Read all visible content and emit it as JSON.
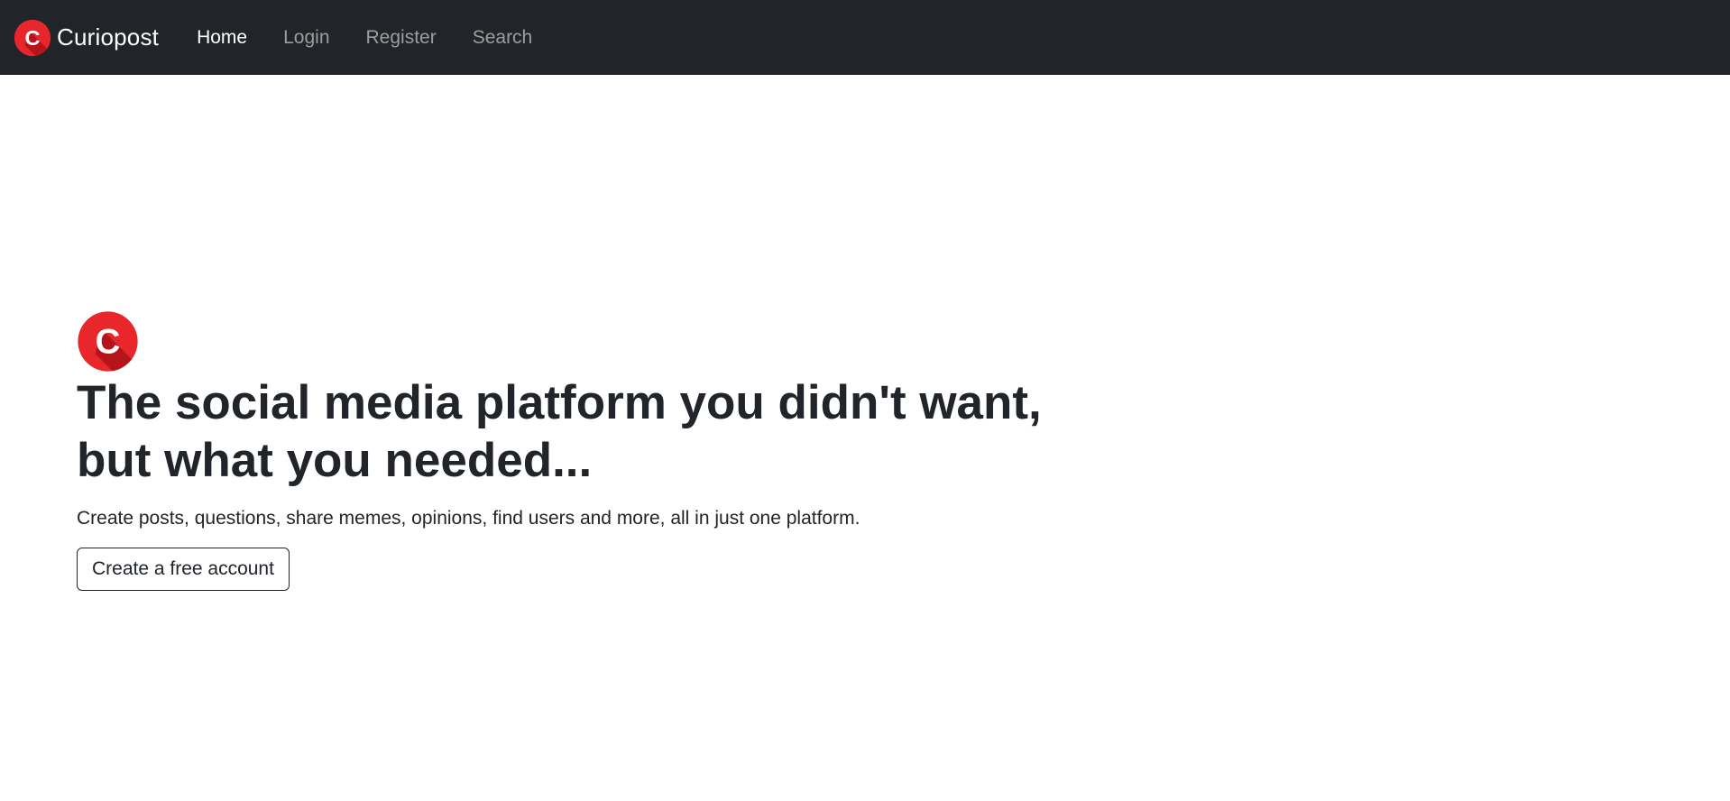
{
  "navbar": {
    "brand_name": "Curiopost",
    "logo_icon": "curiopost-logo-icon",
    "links": [
      {
        "label": "Home",
        "active": true
      },
      {
        "label": "Login",
        "active": false
      },
      {
        "label": "Register",
        "active": false
      },
      {
        "label": "Search",
        "active": false
      }
    ]
  },
  "hero": {
    "logo_icon": "curiopost-logo-icon",
    "title": "The social media platform you didn't want, but what you needed...",
    "subtitle": "Create posts, questions, share memes, opinions, find users and more, all in just one platform.",
    "cta_label": "Create a free account"
  },
  "colors": {
    "navbar_bg": "#212529",
    "logo_red": "#e8262b",
    "logo_dark_red": "#b5151a",
    "text": "#212529"
  }
}
